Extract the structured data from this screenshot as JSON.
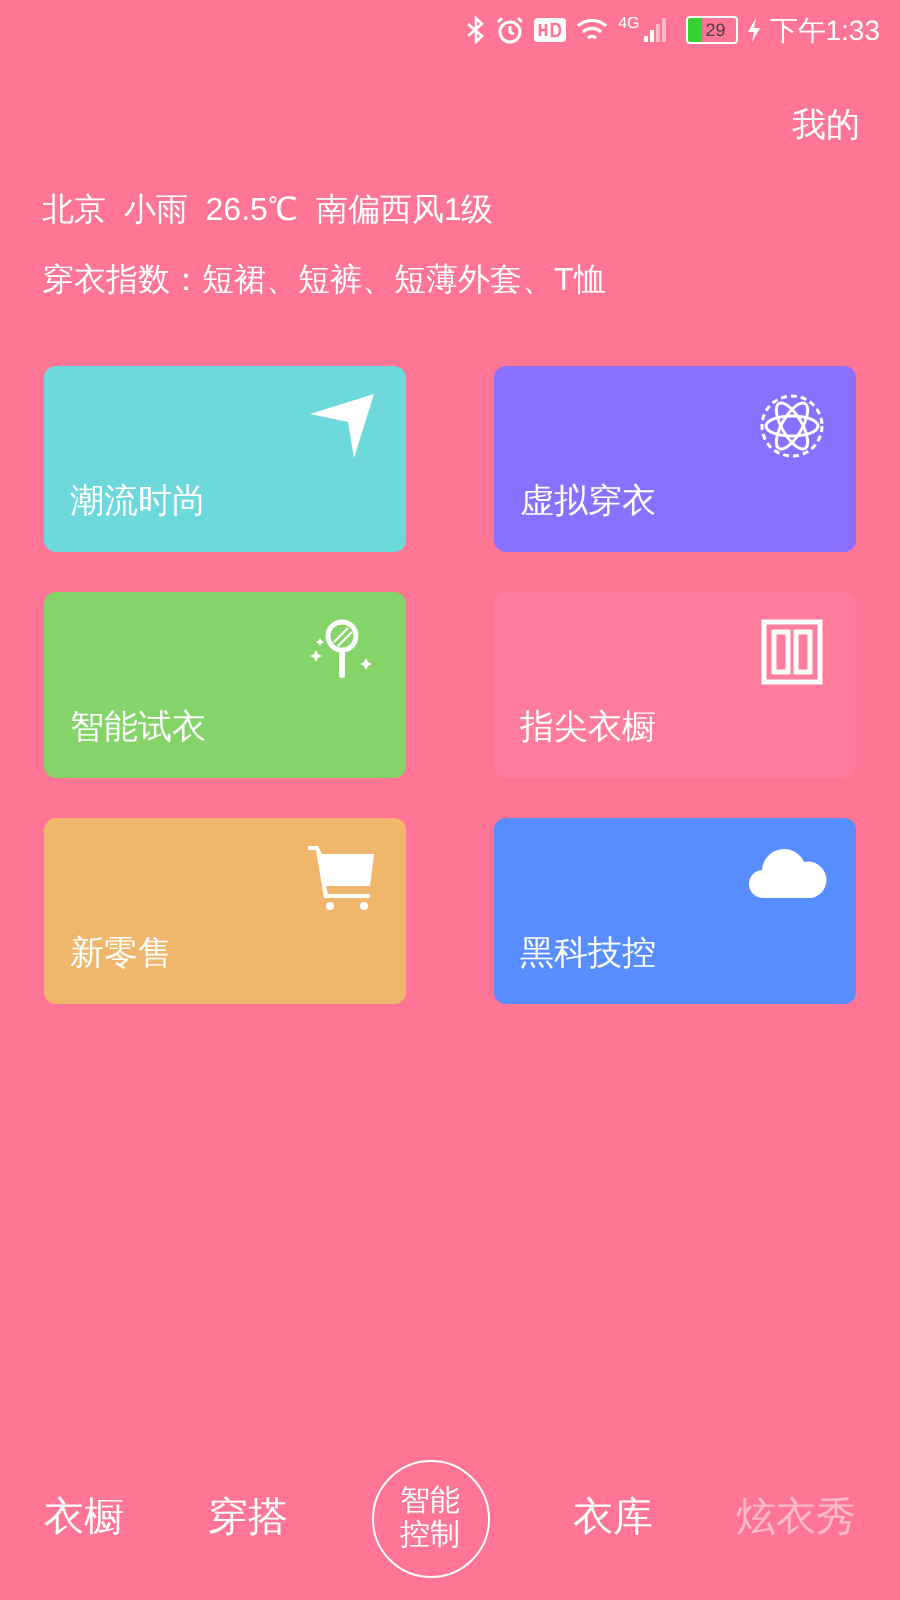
{
  "status_bar": {
    "network": "4G",
    "battery": "29",
    "time": "下午1:33"
  },
  "header": {
    "profile_link": "我的"
  },
  "weather": {
    "line": "北京  小雨  26.5℃  南偏西风1级",
    "dress_index": "穿衣指数：短裙、短裤、短薄外套、T恤"
  },
  "tiles": [
    {
      "label": "潮流时尚",
      "color": "#6dd9dd"
    },
    {
      "label": "虚拟穿衣",
      "color": "#8a70ff"
    },
    {
      "label": "智能试衣",
      "color": "#84d46a"
    },
    {
      "label": "指尖衣橱",
      "color": "#ff7c9c"
    },
    {
      "label": "新零售",
      "color": "#efb66c"
    },
    {
      "label": "黑科技控",
      "color": "#578dff"
    }
  ],
  "bottom_nav": [
    {
      "kind": "text",
      "label": "衣橱",
      "disabled": false
    },
    {
      "kind": "text",
      "label": "穿搭",
      "disabled": false
    },
    {
      "kind": "circle",
      "label": "智能控制",
      "disabled": false
    },
    {
      "kind": "text",
      "label": "衣库",
      "disabled": false
    },
    {
      "kind": "text",
      "label": "炫衣秀",
      "disabled": true
    }
  ]
}
